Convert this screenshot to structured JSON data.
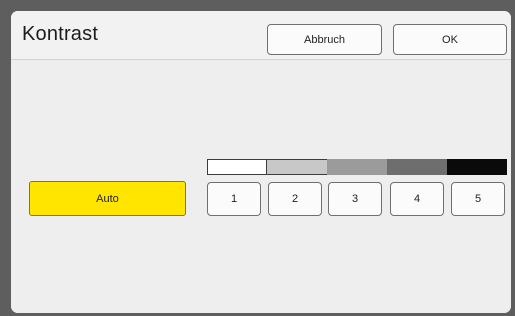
{
  "dialog": {
    "title": "Kontrast",
    "cancel_label": "Abbruch",
    "ok_label": "OK"
  },
  "auto_button": {
    "label": "Auto",
    "color": "#ffe500"
  },
  "contrast_levels": [
    {
      "label": "1",
      "shade": "#ffffff"
    },
    {
      "label": "2",
      "shade": "#c8c8c8"
    },
    {
      "label": "3",
      "shade": "#9b9b9b"
    },
    {
      "label": "4",
      "shade": "#6e6e6e"
    },
    {
      "label": "5",
      "shade": "#0a0a0a"
    }
  ]
}
